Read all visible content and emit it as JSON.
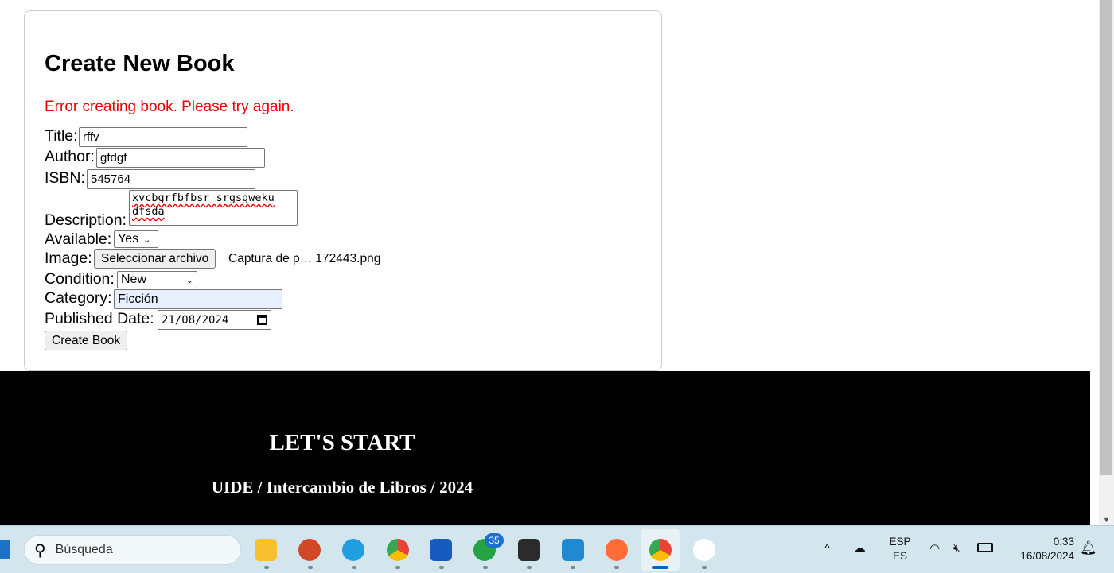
{
  "form": {
    "title": "Create New Book",
    "error": "Error creating book. Please try again.",
    "fields": {
      "title_label": "Title:",
      "title_value": "rffv",
      "author_label": "Author:",
      "author_value": "gfdgf",
      "isbn_label": "ISBN:",
      "isbn_value": "545764",
      "description_label": "Description:",
      "description_value": "xvcbgrfbfbsr srgsgweku dfsda",
      "available_label": "Available:",
      "available_value": "Yes",
      "image_label": "Image:",
      "image_button": "Seleccionar archivo",
      "image_file": "Captura de p… 172443.png",
      "condition_label": "Condition:",
      "condition_value": "New",
      "category_label": "Category:",
      "category_value": "Ficción",
      "date_label": "Published Date:",
      "date_value": "21/08/2024"
    },
    "submit": "Create Book"
  },
  "footer": {
    "heading": "LET'S START",
    "subtitle": "UIDE / Intercambio de Libros / 2024"
  },
  "taskbar": {
    "search_placeholder": "Búsqueda",
    "apps": [
      "file-explorer",
      "powerpoint",
      "edge",
      "chrome",
      "word",
      "whatsapp",
      "terminal",
      "vscode",
      "postman",
      "chrome-profile",
      "mongodb-compass"
    ],
    "whatsapp_badge": "35",
    "lang_top": "ESP",
    "lang_bottom": "ES",
    "time": "0:33",
    "date": "16/08/2024"
  }
}
